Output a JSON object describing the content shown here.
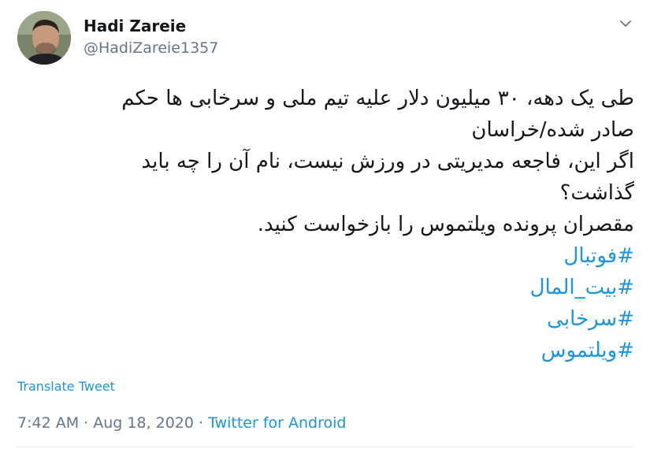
{
  "author": {
    "name": "Hadi Zareie",
    "handle": "@HadiZareie1357",
    "avatar_icon": "profile-photo"
  },
  "menu": {
    "icon": "chevron-down-icon"
  },
  "tweet": {
    "lines": [
      "طی یک دهه، ۳۰ میلیون دلار علیه تیم ملی و سرخابی ها حکم",
      "صادر شده/خراسان",
      "اگر این، فاجعه مدیریتی در ورزش نیست، نام آن را چه باید",
      "گذاشت؟",
      "مقصران پرونده ویلتموس را بازخواست کنید."
    ],
    "hashtags": [
      "#فوتبال",
      "#بیت_المال",
      " #سرخابی",
      "#ویلتموس"
    ]
  },
  "translate_label": "Translate Tweet",
  "meta": {
    "time": "7:42 AM",
    "separator": " · ",
    "date": "Aug 18, 2020",
    "source": "Twitter for Android"
  },
  "colors": {
    "link": "#1b95e0",
    "text": "#14171a",
    "secondary": "#657786"
  }
}
